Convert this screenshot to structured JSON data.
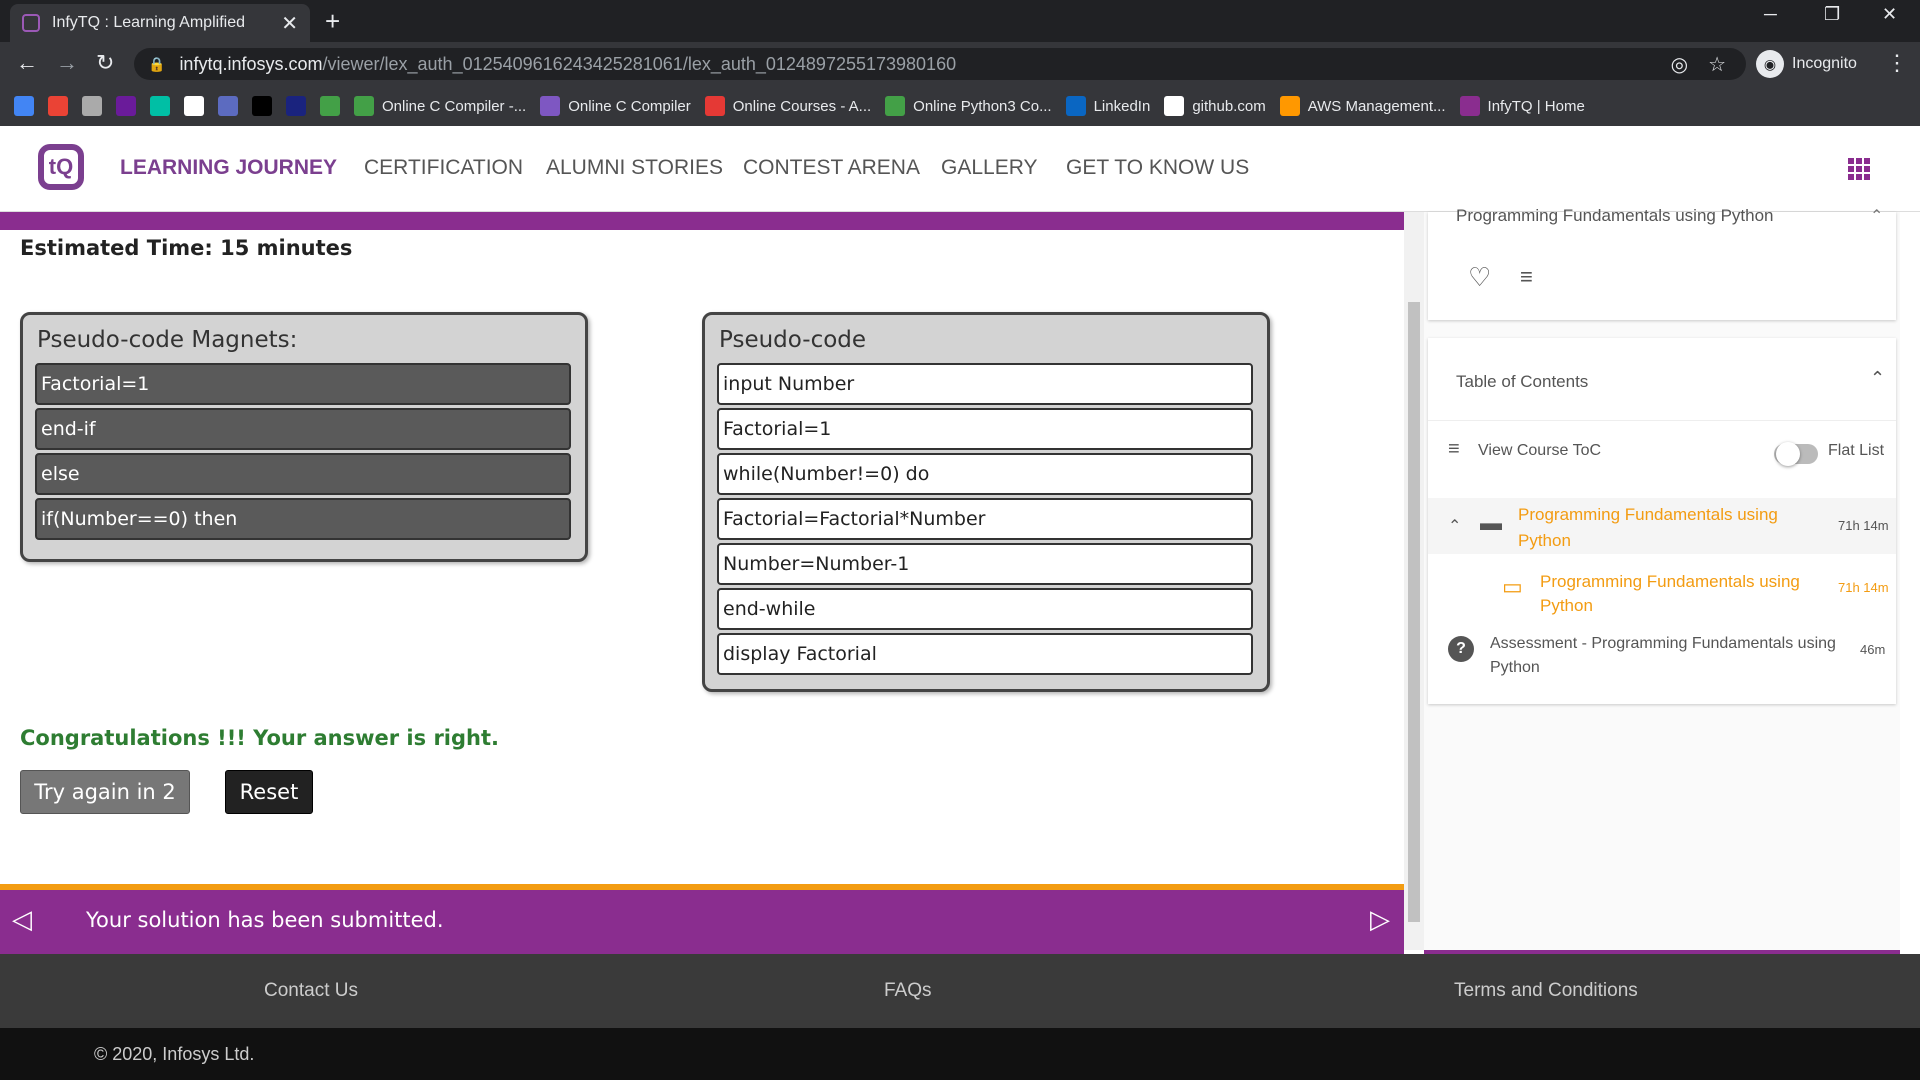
{
  "browser": {
    "tab_title": "InfyTQ : Learning Amplified",
    "url_host": "infytq.infosys.com",
    "url_path": "/viewer/lex_auth_012540961624342528106​1/lex_auth_0124897255173980160",
    "incognito_label": "Incognito",
    "bookmarks": [
      {
        "label": "",
        "color": "#4285f4"
      },
      {
        "label": "",
        "color": "#ea4335"
      },
      {
        "label": "",
        "color": "#aaaaaa"
      },
      {
        "label": "",
        "color": "#6a1b9a"
      },
      {
        "label": "",
        "color": "#00bfa5"
      },
      {
        "label": "",
        "color": "#ffffff"
      },
      {
        "label": "",
        "color": "#5c6bc0"
      },
      {
        "label": "",
        "color": "#000000"
      },
      {
        "label": "",
        "color": "#1a237e"
      },
      {
        "label": "",
        "color": "#43a047"
      },
      {
        "label": "Online C Compiler -...",
        "color": "#43a047"
      },
      {
        "label": "Online C Compiler",
        "color": "#7e57c2"
      },
      {
        "label": "Online Courses - A...",
        "color": "#e53935"
      },
      {
        "label": "Online Python3 Co...",
        "color": "#43a047"
      },
      {
        "label": "LinkedIn",
        "color": "#0a66c2"
      },
      {
        "label": "github.com",
        "color": "#ffffff"
      },
      {
        "label": "AWS Management...",
        "color": "#ff9800"
      },
      {
        "label": "InfyTQ | Home",
        "color": "#8a2d8f"
      }
    ]
  },
  "site": {
    "logo_text": "tQ",
    "nav": [
      "LEARNING JOURNEY",
      "CERTIFICATION",
      "ALUMNI STORIES",
      "CONTEST ARENA",
      "GALLERY",
      "GET TO KNOW US"
    ]
  },
  "exercise": {
    "estimated_time": "Estimated Time: 15 minutes",
    "magnets_title": "Pseudo-code Magnets:",
    "magnets": [
      "Factorial=1",
      "end-if",
      "else",
      "if(Number==0) then"
    ],
    "code_title": "Pseudo-code",
    "code_lines": [
      "input Number",
      "Factorial=1",
      "while(Number!=0) do",
      "Factorial=Factorial*Number",
      "Number=Number-1",
      "end-while",
      "display Factorial"
    ],
    "congrats": "Congratulations !!! Your answer is right.",
    "try_again_label": "Try again in 2",
    "reset_label": "Reset",
    "submitted_msg": "Your solution has been submitted."
  },
  "sidebar": {
    "course_title": "Programming Fundamentals using Python",
    "toc_title": "Table of Contents",
    "view_toc_label": "View Course ToC",
    "flat_list_label": "Flat List",
    "items": [
      {
        "title": "Programming Fundamentals using Python",
        "duration": "71h 14m"
      },
      {
        "title": "Programming Fundamentals using Python",
        "duration": "71h 14m"
      },
      {
        "title": "Assessment - Programming Fundamentals using Python",
        "duration": "46m"
      }
    ]
  },
  "footer": {
    "contact": "Contact Us",
    "faqs": "FAQs",
    "terms": "Terms and Conditions",
    "copyright": "© 2020, Infosys Ltd."
  }
}
